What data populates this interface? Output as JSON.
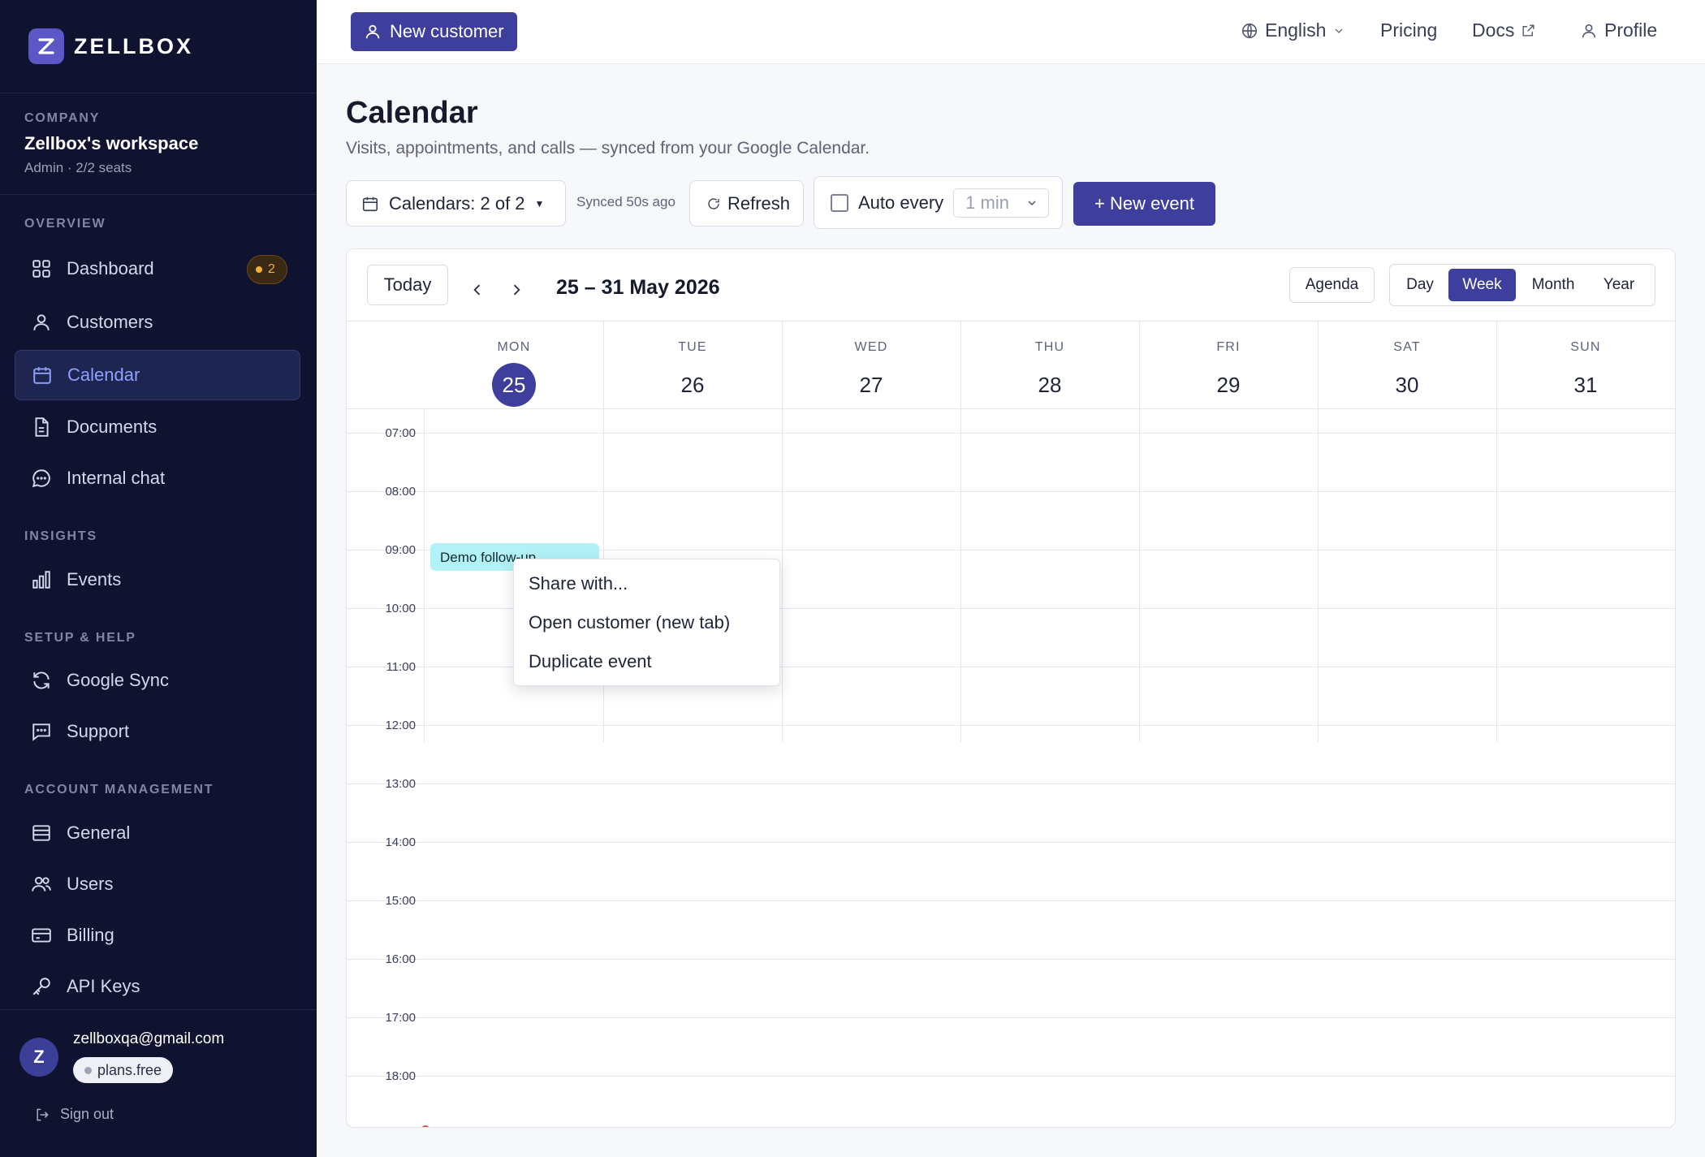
{
  "brand": {
    "name": "ZELLBOX",
    "logo_letter": "Z"
  },
  "workspace": {
    "section": "COMPANY",
    "name": "Zellbox's workspace",
    "meta": "Admin · 2/2 seats"
  },
  "sidebar": {
    "sections": {
      "overview": "OVERVIEW",
      "insights": "INSIGHTS",
      "setup": "SETUP & HELP",
      "account": "ACCOUNT MANAGEMENT"
    },
    "items": [
      {
        "label": "Dashboard",
        "icon": "grid-icon",
        "badge": "2"
      },
      {
        "label": "Customers",
        "icon": "user-icon"
      },
      {
        "label": "Calendar",
        "icon": "calendar-icon",
        "active": true
      },
      {
        "label": "Documents",
        "icon": "document-icon"
      },
      {
        "label": "Internal chat",
        "icon": "chat-icon"
      },
      {
        "label": "Events",
        "icon": "bar-chart-icon"
      },
      {
        "label": "Google Sync",
        "icon": "sync-icon"
      },
      {
        "label": "Support",
        "icon": "message-icon"
      },
      {
        "label": "General",
        "icon": "list-icon"
      },
      {
        "label": "Users",
        "icon": "users-icon"
      },
      {
        "label": "Billing",
        "icon": "credit-card-icon"
      },
      {
        "label": "API Keys",
        "icon": "key-icon"
      }
    ],
    "user": {
      "avatar": "Z",
      "email": "zellboxqa@gmail.com",
      "plan": "plans.free"
    },
    "signout": "Sign out"
  },
  "topbar": {
    "new_customer": "New customer",
    "language": "English",
    "pricing": "Pricing",
    "docs": "Docs",
    "profile": "Profile"
  },
  "page": {
    "title": "Calendar",
    "subtitle": "Visits, appointments, and calls — synced from your Google Calendar."
  },
  "toolbar": {
    "calendars": "Calendars: 2 of 2",
    "synced": "Synced 50s ago",
    "refresh": "Refresh",
    "auto_every": "Auto every",
    "interval": "1 min",
    "new_event": "+ New event"
  },
  "calendar": {
    "today_btn": "Today",
    "range": "25 – 31 May 2026",
    "views": [
      "Agenda",
      "Day",
      "Week",
      "Month",
      "Year"
    ],
    "active_view": "Week",
    "days": [
      {
        "dow": "MON",
        "num": "25",
        "today": true
      },
      {
        "dow": "TUE",
        "num": "26"
      },
      {
        "dow": "WED",
        "num": "27"
      },
      {
        "dow": "THU",
        "num": "28"
      },
      {
        "dow": "FRI",
        "num": "29"
      },
      {
        "dow": "SAT",
        "num": "30"
      },
      {
        "dow": "SUN",
        "num": "31"
      }
    ],
    "hours": [
      "07:00",
      "08:00",
      "09:00",
      "10:00",
      "11:00",
      "12:00",
      "13:00",
      "14:00",
      "15:00",
      "16:00",
      "17:00",
      "18:00"
    ],
    "event": {
      "title": "Demo follow-up",
      "color": "#b2f1f6"
    }
  },
  "context_menu": [
    "Share with...",
    "Open customer (new tab)",
    "Duplicate event"
  ],
  "colors": {
    "accent": "#3e3f9c",
    "sidebar_bg": "#0f1330",
    "badge": "#f2b13a"
  }
}
